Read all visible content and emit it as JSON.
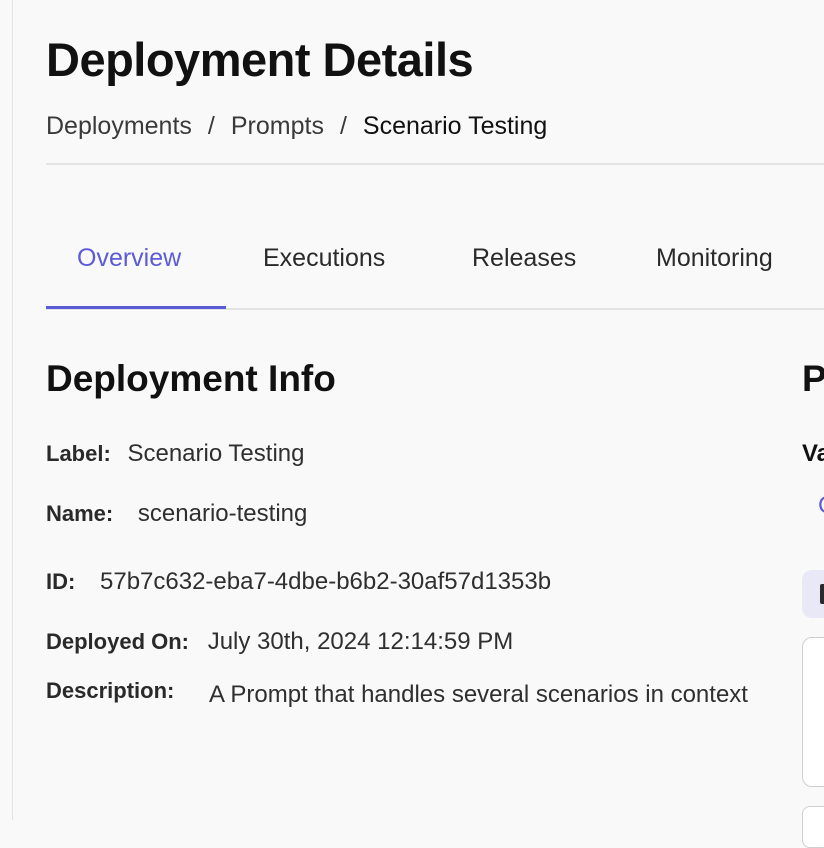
{
  "header": {
    "title": "Deployment Details",
    "breadcrumb": {
      "items": [
        "Deployments",
        "Prompts",
        "Scenario Testing"
      ],
      "separator": "/"
    }
  },
  "tabs": [
    {
      "label": "Overview",
      "active": true
    },
    {
      "label": "Executions",
      "active": false
    },
    {
      "label": "Releases",
      "active": false
    },
    {
      "label": "Monitoring",
      "active": false
    }
  ],
  "deployment_info": {
    "title": "Deployment Info",
    "label": {
      "key": "Label:",
      "value": "Scenario Testing"
    },
    "name": {
      "key": "Name:",
      "value": "scenario-testing"
    },
    "id": {
      "key": "ID:",
      "value": "57b7c632-eba7-4dbe-b6b2-30af57d1353b"
    },
    "deployed_on": {
      "key": "Deployed On:",
      "value": "July 30th, 2024 12:14:59 PM"
    },
    "description": {
      "key": "Description:",
      "value": "A Prompt that handles several scenarios in context"
    }
  },
  "right_panel": {
    "title_fragment": "P",
    "subtitle_fragment": "Va",
    "link_fragment": "C"
  },
  "colors": {
    "accent": "#5b5bd6",
    "background": "#f9f9f9",
    "divider": "#e4e4e4",
    "text": "#111111"
  }
}
